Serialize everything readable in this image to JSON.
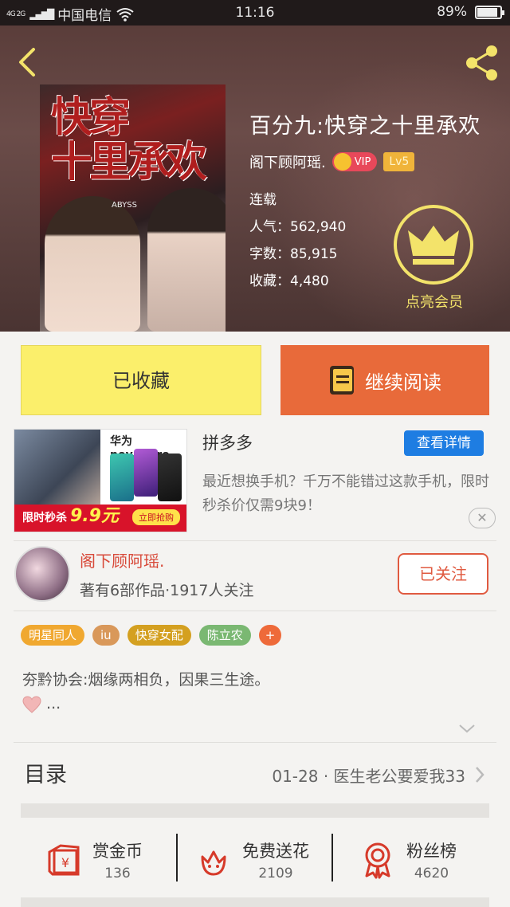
{
  "status_bar": {
    "signal": "4G 2G",
    "carrier": "中国电信",
    "time": "11:16",
    "battery": "89%",
    "battery_level": 0.89
  },
  "book": {
    "title": "百分九:快穿之十里承欢",
    "author": "阁下顾阿瑶.",
    "vip_label": "VIP",
    "level": "Lv5",
    "status": "连载",
    "popularity": "人气：562,940",
    "word_count": "字数：85,915",
    "favorites": "收藏：4,480",
    "member_label": "点亮会员",
    "cover_title": "快穿\n十里承欢",
    "cover_sub": "ABYSS"
  },
  "actions": {
    "collected": "已收藏",
    "continue_reading": "继续阅读"
  },
  "ad": {
    "image_brand": "华为nova5Pro",
    "image_promo": "限时秒杀",
    "image_price": "9.9元",
    "image_cta": "立即抢购",
    "brand": "拼多多",
    "detail_button": "查看详情",
    "description": "最近想换手机？千万不能错过这款手机，限时秒杀价仅需9块9！",
    "close": "✕"
  },
  "author_card": {
    "name": "阁下顾阿瑶.",
    "info": "著有6部作品·1917人关注",
    "follow_button": "已关注"
  },
  "tags": [
    {
      "label": "明星同人",
      "color": "#f0a830"
    },
    {
      "label": "iu",
      "color": "#d9985a"
    },
    {
      "label": "快穿女配",
      "color": "#d4a020"
    },
    {
      "label": "陈立农",
      "color": "#7ab872"
    },
    {
      "label": "+",
      "color": "#ee6a3a"
    }
  ],
  "synopsis": {
    "text": "夯黔协会:烟缘两相负，因果三生途。",
    "more": "..."
  },
  "catalog": {
    "label": "目录",
    "latest": "01-28 · 医生老公要爱我33"
  },
  "bottom_stats": [
    {
      "label": "赏金币",
      "value": "136",
      "icon": "red-envelope-icon"
    },
    {
      "label": "免费送花",
      "value": "2109",
      "icon": "flower-icon"
    },
    {
      "label": "粉丝榜",
      "value": "4620",
      "icon": "medal-icon"
    }
  ],
  "colors": {
    "accent_orange": "#e86a3a",
    "collected_yellow": "#fbef6b",
    "member_gold": "#f3e36a",
    "link_blue": "#1e7de2"
  }
}
